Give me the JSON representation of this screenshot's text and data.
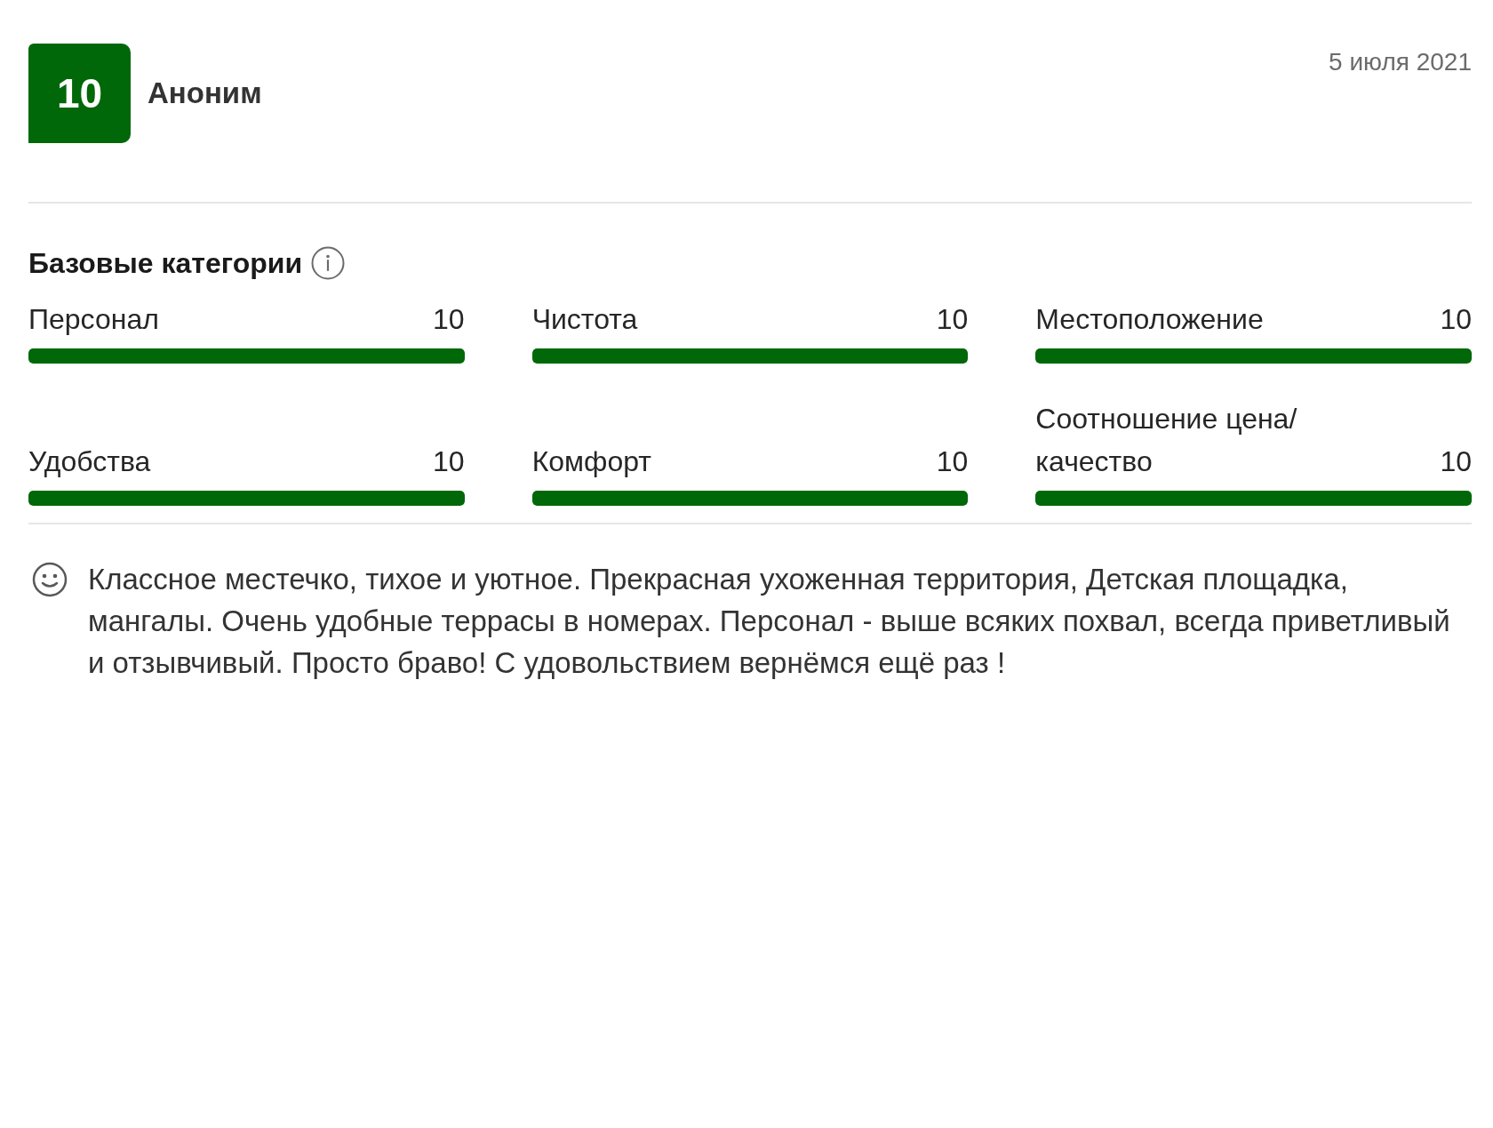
{
  "review": {
    "score": "10",
    "author": "Аноним",
    "date": "5 июля 2021"
  },
  "categories": {
    "title": "Базовые категории",
    "items": [
      {
        "name": "Персонал",
        "score": "10",
        "level": 1
      },
      {
        "name": "Чистота",
        "score": "10",
        "level": 1
      },
      {
        "name": "Местоположение",
        "score": "10",
        "level": 1
      },
      {
        "name": "Удобства",
        "score": "10",
        "level": 1
      },
      {
        "name": "Комфорт",
        "score": "10",
        "level": 1
      },
      {
        "name": "Соотношение цена/качество",
        "score": "10",
        "level": 1
      }
    ]
  },
  "comment": {
    "kind": "positive",
    "text": "Классное местечко, тихое и уютное. Прекрасная ухоженная территория, Детская площадка, мангалы. Очень удобные террасы в номерах. Персонал - выше всяких похвал, всегда приветливый и отзывчивый. Просто браво! С удовольствием вернёмся ещё раз !"
  }
}
